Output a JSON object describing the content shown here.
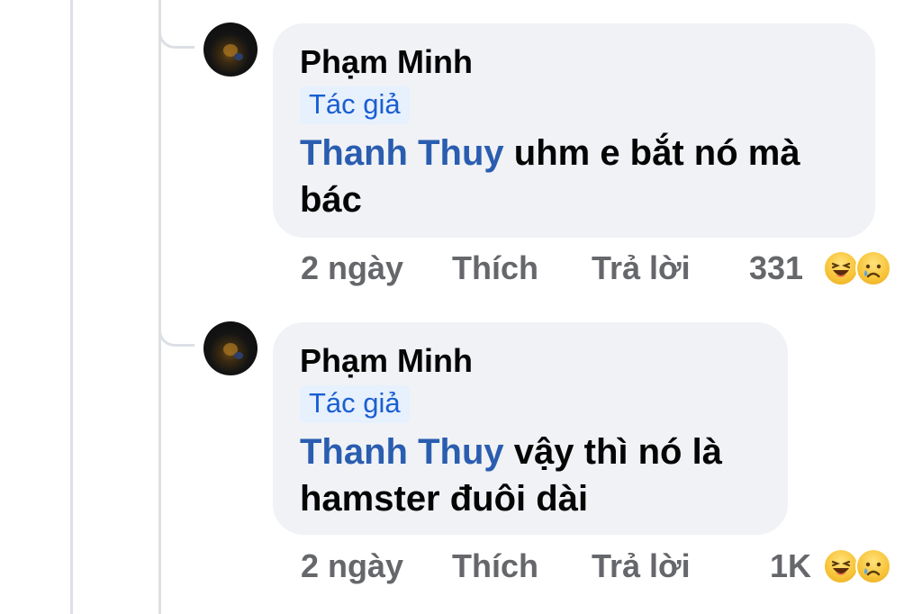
{
  "comments": [
    {
      "author": "Phạm Minh",
      "badge": "Tác giả",
      "mention": "Thanh Thuy",
      "text": "uhm e bắt nó mà bác",
      "time": "2 ngày",
      "like_label": "Thích",
      "reply_label": "Trả lời",
      "reaction_count": "331",
      "reaction_icons": [
        "haha-icon",
        "sad-icon"
      ]
    },
    {
      "author": "Phạm Minh",
      "badge": "Tác giả",
      "mention": "Thanh Thuy",
      "text": "vậy thì nó là hamster đuôi dài",
      "time": "2 ngày",
      "like_label": "Thích",
      "reply_label": "Trả lời",
      "reaction_count": "1K",
      "reaction_icons": [
        "haha-icon",
        "sad-icon"
      ]
    }
  ],
  "colors": {
    "bubble_bg": "#f0f2f5",
    "mention": "#2a5db0",
    "badge_bg": "#e7f0fd",
    "badge_text": "#1a5fd1",
    "meta_text": "#65676b"
  }
}
